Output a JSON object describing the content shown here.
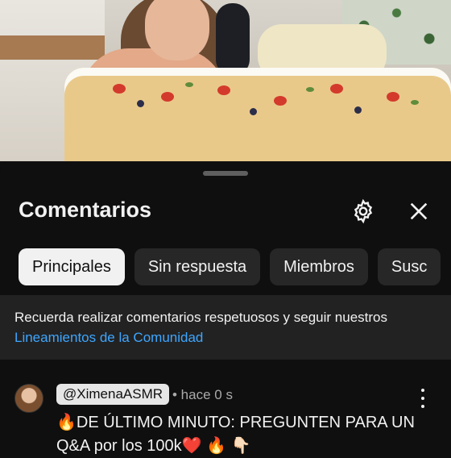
{
  "comments_panel": {
    "title": "Comentarios",
    "filters": [
      "Principales",
      "Sin respuesta",
      "Miembros",
      "Susc"
    ],
    "active_filter": "Principales",
    "notice": {
      "text": "Recuerda realizar comentarios respetuosos y seguir nuestros",
      "link": "Lineamientos de la Comunidad"
    },
    "comment": {
      "author": "@XimenaASMR",
      "time": "• hace 0 s",
      "text_line1": "🔥DE ÚLTIMO MINUTO: PREGUNTEN PARA UN",
      "text_line2": "Q&A por los 100k❤️ 🔥 👇🏻"
    }
  },
  "icons": {
    "settings": "gear-icon",
    "close": "close-icon",
    "menu": "more-vert-icon"
  },
  "colors": {
    "background": "#0f0f0f",
    "link": "#3ea6ff",
    "chip": "#272727",
    "chip_active": "#f1f1f1"
  }
}
